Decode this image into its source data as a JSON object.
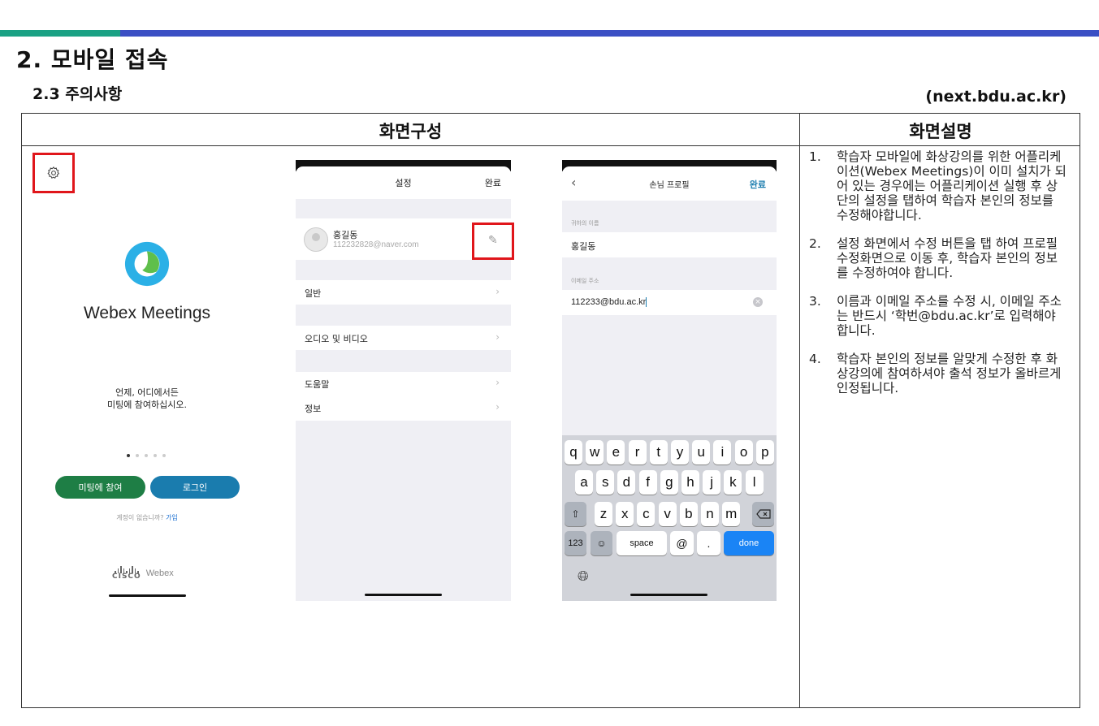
{
  "colors": {
    "bar_green": "#1aa184",
    "bar_blue": "#3b4fc4",
    "highlight_red": "#e0161b",
    "webex_green": "#1e7e45",
    "webex_blue": "#1a7cae",
    "ios_blue": "#1a84f5"
  },
  "page": {
    "heading": "2. 모바일 접속",
    "subheading": "2.3 주의사항",
    "site": "(next.bdu.ac.kr)"
  },
  "table": {
    "col_left": "화면구성",
    "col_right": "화면설명"
  },
  "phone1": {
    "settings_icon": "gear-icon",
    "app_name": "Webex Meetings",
    "tagline_line1": "언제, 어디에서든",
    "tagline_line2": "미팅에 참여하십시오.",
    "page_dots": 5,
    "active_dot": 1,
    "join_button": "미팅에 참여",
    "login_button": "로그인",
    "no_account": "계정이 없습니까?",
    "signup_link": "가입",
    "cisco_label": "CISCO",
    "webex_label": "Webex"
  },
  "phone2": {
    "title": "설정",
    "done": "완료",
    "profile_name": "홍길동",
    "profile_email": "112232828@naver.com",
    "edit_icon": "pencil-icon",
    "items": [
      "일반",
      "오디오 및 비디오",
      "도움말",
      "정보"
    ]
  },
  "phone3": {
    "back_icon": "chevron-left-icon",
    "title": "손님 프로필",
    "done": "완료",
    "name_label": "귀하의 이름",
    "name_value": "홍길동",
    "email_label": "이메일 주소",
    "email_value": "112233@bdu.ac.kr",
    "keyboard_row1": [
      "q",
      "w",
      "e",
      "r",
      "t",
      "y",
      "u",
      "i",
      "o",
      "p"
    ],
    "keyboard_row2": [
      "a",
      "s",
      "d",
      "f",
      "g",
      "h",
      "j",
      "k",
      "l"
    ],
    "keyboard_row3": [
      "z",
      "x",
      "c",
      "v",
      "b",
      "n",
      "m"
    ],
    "key_123": "123",
    "key_space": "space",
    "key_at": "@",
    "key_dot": ".",
    "key_done": "done"
  },
  "notes": [
    {
      "num": "1.",
      "text": "학습자 모바일에 화상강의를 위한 어플리케이션(Webex Meetings)이 이미 설치가 되어 있는 경우에는 어플리케이션 실행 후 상단의 설정을 탭하여 학습자 본인의 정보를 수정해야합니다."
    },
    {
      "num": "2.",
      "text": "설정 화면에서 수정 버튼을 탭 하여 프로필 수정화면으로 이동 후, 학습자 본인의 정보를 수정하여야 합니다."
    },
    {
      "num": "3.",
      "text": "이름과 이메일 주소를 수정 시, 이메일 주소는 반드시 ‘학번@bdu.ac.kr’로 입력해야 합니다."
    },
    {
      "num": "4.",
      "text": "학습자 본인의 정보를 알맞게 수정한 후 화상강의에 참여하셔야 출석 정보가 올바르게 인정됩니다."
    }
  ]
}
